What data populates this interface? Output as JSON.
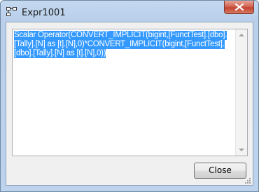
{
  "window": {
    "title": "Expr1001",
    "icon": "expression-tree-icon",
    "close_glyph": "x-icon"
  },
  "textbox": {
    "lines": [
      "Scalar Operator(CONVERT_IMPLICIT(bigint,[FunctTest].[dbo].",
      "[Tally].[N] as [t].[N],0)*CONVERT_IMPLICIT(bigint,[FunctTest].",
      "[dbo].[Tally].[N] as [t].[N],0))"
    ],
    "selected": true
  },
  "buttons": {
    "close_label": "Close"
  },
  "colors": {
    "selection": "#3399ff",
    "close_x": "#c44431",
    "frame": "#bdd2ec"
  }
}
